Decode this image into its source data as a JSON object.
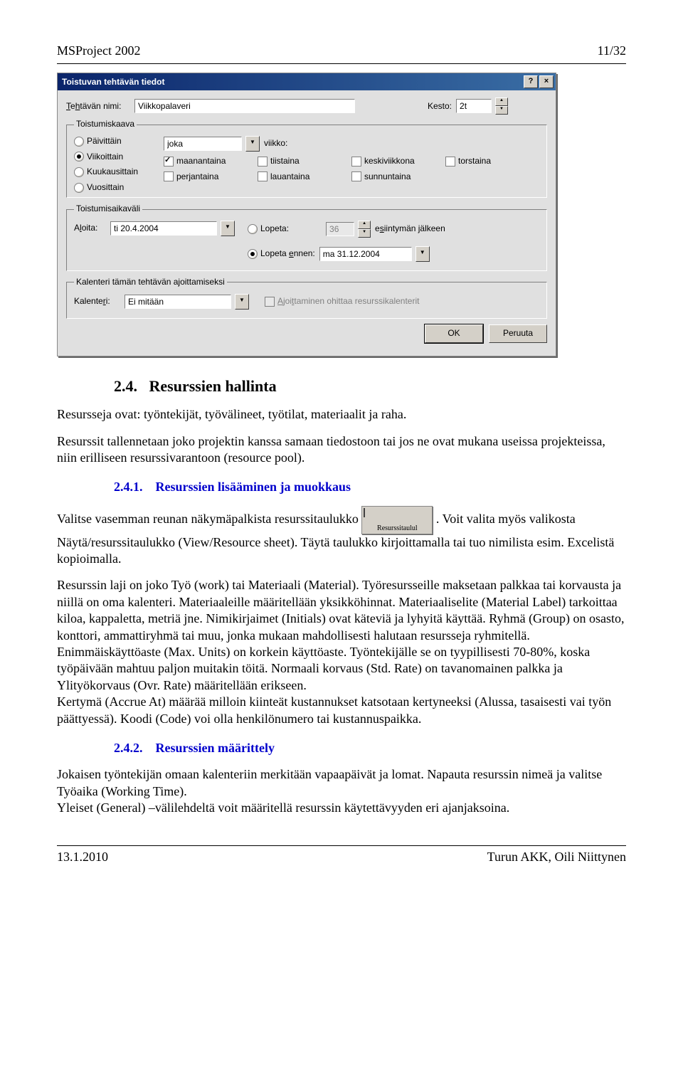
{
  "header": {
    "left": "MSProject 2002",
    "right": "11/32"
  },
  "dialog": {
    "title": "Toistuvan tehtävän tiedot",
    "help_symbol": "?",
    "close_symbol": "×",
    "name_label": "Tehtävän nimi:",
    "name_value": "Viikkopalaveri",
    "duration_label": "Kesto:",
    "duration_value": "2t",
    "pattern_group": "Toistumiskaava",
    "radios": {
      "daily": "Päivittäin",
      "weekly": "Viikoittain",
      "monthly": "Kuukausittain",
      "yearly": "Vuosittain"
    },
    "every_value": "joka",
    "week_label": "viikko:",
    "days": {
      "mon": "maanantaina",
      "tue": "tiistaina",
      "wed": "keskiviikkona",
      "thu": "torstaina",
      "fri": "perjantaina",
      "sat": "lauantaina",
      "sun": "sunnuntaina"
    },
    "range_group": "Toistumisaikaväli",
    "start_label": "Aloita:",
    "start_value": "ti 20.4.2004",
    "end_after_label": "Lopeta:",
    "end_after_value": "36",
    "end_after_suffix": "esiintymän jälkeen",
    "end_by_label": "Lopeta ennen:",
    "end_by_value": "ma 31.12.2004",
    "calendar_group": "Kalenteri tämän tehtävän ajoittamiseksi",
    "calendar_label": "Kalenteri:",
    "calendar_value": "Ei mitään",
    "calendar_check": "Ajoittaminen ohittaa resurssikalenterit",
    "ok": "OK",
    "cancel": "Peruuta"
  },
  "sections": {
    "s24_num": "2.4.",
    "s24_title": "Resurssien hallinta",
    "s241_num": "2.4.1.",
    "s241_title": "Resurssien lisääminen ja muokkaus",
    "s242_num": "2.4.2.",
    "s242_title": "Resurssien määrittely"
  },
  "para": {
    "p1": "Resursseja ovat: työntekijät, työvälineet, työtilat, materiaalit ja raha.",
    "p2": "Resurssit tallennetaan joko projektin kanssa samaan tiedostoon tai jos ne ovat mukana useissa projekteissa, niin erilliseen resurssivarantoon (resource pool).",
    "p3a": "Valitse vasemman reunan näkymäpalkista resurssitaulukko ",
    "icon_label": "Resurssitaulul",
    "p3b": ". Voit valita myös valikosta Näytä/resurssitaulukko (View/Resource sheet). Täytä taulukko kirjoittamalla tai tuo nimilista esim. Excelistä kopioimalla.",
    "p4": "Resurssin laji on joko Työ (work) tai Materiaali (Material). Työresursseille maksetaan palkkaa tai korvausta ja niillä on oma kalenteri. Materiaaleille määritellään yksikköhinnat. Materiaaliselite (Material Label) tarkoittaa kiloa, kappaletta, metriä jne. Nimikirjaimet (Initials) ovat käteviä ja lyhyitä käyttää. Ryhmä (Group) on osasto, konttori, ammattiryhmä tai muu, jonka mukaan mahdollisesti halutaan resursseja ryhmitellä.",
    "p5": " Enimmäiskäyttöaste (Max. Units) on korkein käyttöaste. Työntekijälle se on tyypillisesti 70-80%, koska työpäivään mahtuu paljon muitakin töitä. Normaali korvaus (Std. Rate) on tavanomainen palkka ja Ylityökorvaus (Ovr. Rate) määritellään erikseen.",
    "p6": "Kertymä (Accrue At) määrää milloin kiinteät kustannukset katsotaan kertyneeksi (Alussa, tasaisesti vai työn päättyessä). Koodi (Code) voi olla henkilönumero tai kustannuspaikka.",
    "p7": "Jokaisen työntekijän omaan kalenteriin merkitään vapaapäivät ja lomat. Napauta resurssin nimeä ja valitse Työaika (Working Time).",
    "p8": "Yleiset (General) –välilehdeltä voit määritellä resurssin käytettävyyden eri ajanjaksoina."
  },
  "footer": {
    "left": "13.1.2010",
    "right": "Turun AKK, Oili Niittynen"
  }
}
